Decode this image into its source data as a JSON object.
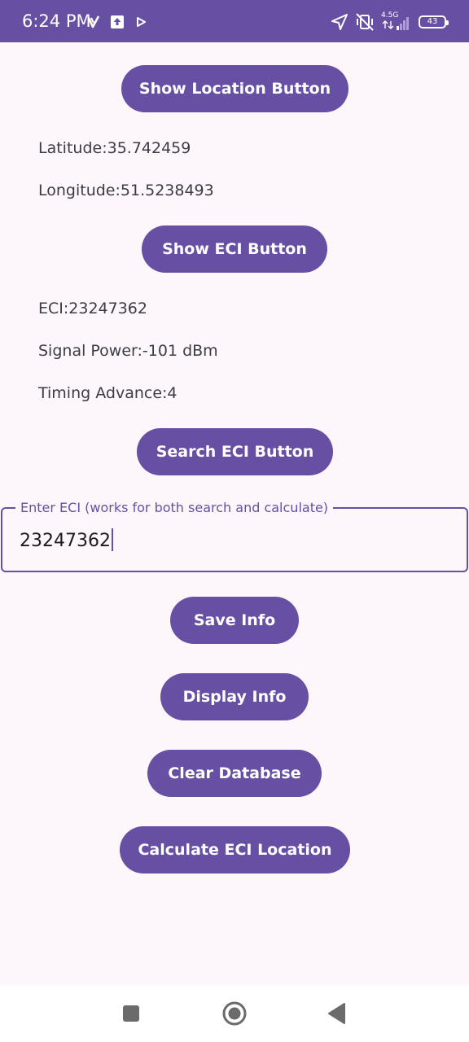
{
  "status_bar": {
    "time": "6:24 PM",
    "network_type": "4.5G",
    "battery_level": "43",
    "background_color": "#6750a4"
  },
  "buttons": {
    "show_location": "Show Location Button",
    "show_eci": "Show ECI Button",
    "search_eci": "Search ECI Button",
    "save_info": "Save Info",
    "display_info": "Display Info",
    "clear_database": "Clear Database",
    "calculate_eci_location": "Calculate ECI Location"
  },
  "location": {
    "latitude": "Latitude:35.742459",
    "longitude": "Longitude:51.5238493"
  },
  "cell_info": {
    "eci": "ECI:23247362",
    "signal_power": "Signal Power:-101 dBm",
    "timing_advance": "Timing Advance:4"
  },
  "eci_input": {
    "label": "Enter ECI (works for both search and calculate)",
    "value": "23247362"
  },
  "theme": {
    "primary": "#6750a4",
    "background": "#fdf7fb",
    "on_surface": "#3f3a45"
  },
  "icons": {
    "status_left": [
      "v-app-icon",
      "upload-icon",
      "play-icon"
    ],
    "status_right": [
      "location-arrow-icon",
      "vibrate-off-icon",
      "signal-icon",
      "battery-icon"
    ],
    "nav": [
      "recents-square-icon",
      "home-circle-icon",
      "back-triangle-icon"
    ]
  }
}
